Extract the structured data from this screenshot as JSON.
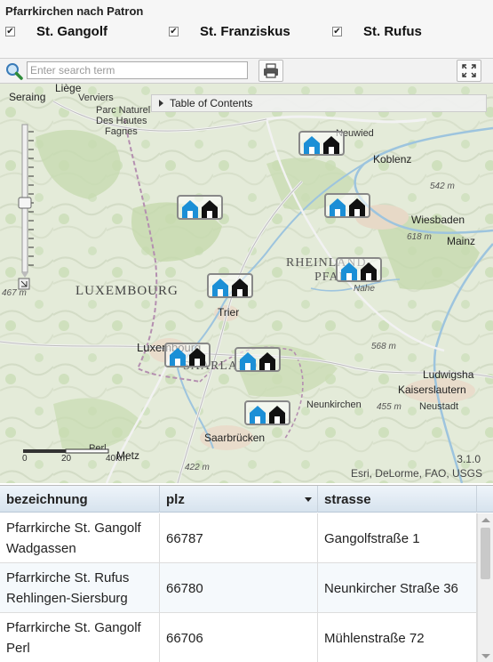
{
  "header": {
    "title": "Pfarrkirchen nach Patron",
    "legend": [
      {
        "label": "St. Gangolf",
        "checked": true,
        "check_mark": "✔"
      },
      {
        "label": "St. Franziskus",
        "checked": true,
        "check_mark": "✔"
      },
      {
        "label": "St. Rufus",
        "checked": true,
        "check_mark": "✔"
      }
    ]
  },
  "toolbar": {
    "search_placeholder": "Enter search term",
    "search_icon": "search-icon",
    "print_icon": "print-icon",
    "fullscreen_icon": "fullscreen-icon"
  },
  "map": {
    "toc_label": "Table of Contents",
    "labels": {
      "seraing": "Seraing",
      "liege": "Liège",
      "verviers": "Verviers",
      "parc_naturel": "Parc Naturel",
      "des_hautes": "Des Hautes",
      "fagnes": "Fagnes",
      "neuwied": "Neuwied",
      "koblenz": "Koblenz",
      "wiesbaden": "Wiesbaden",
      "mainz": "Mainz",
      "rheinland": "RHEINLAND-",
      "pfalz": "PFALZ",
      "nahe": "Nahe",
      "luxembourg_country": "LUXEMBOURG",
      "trier": "Trier",
      "luxembourg_city": "Luxembourg",
      "saarland": "SAARLAND",
      "ludwigshafen": "Ludwigsha",
      "kaiserslautern": "Kaiserslautern",
      "neustadt": "Neustadt",
      "neunkirchen": "Neunkirchen",
      "saarbruecken": "Saarbrücken",
      "perl": "Perl",
      "elev_542": "542 m",
      "elev_618": "618 m",
      "elev_467": "467 m",
      "elev_568": "568 m",
      "elev_455": "455 m",
      "elev_422": "422 m"
    },
    "scale": {
      "t0": "0",
      "t20": "20",
      "t40": "40km",
      "metz": "Metz"
    },
    "version": "3.1.0",
    "attribution": "Esri, DeLorme, FAO, USGS",
    "marker_colors": {
      "blue": "#1b8fd6",
      "black": "#111111"
    }
  },
  "table": {
    "columns": [
      "bezeichnung",
      "plz",
      "strasse"
    ],
    "sorted_column": "plz",
    "rows": [
      {
        "bezeichnung_1": "Pfarrkirche St. Gangolf",
        "bezeichnung_2": "Wadgassen",
        "plz": "66787",
        "strasse": "Gangolfstraße 1"
      },
      {
        "bezeichnung_1": "Pfarrkirche St. Rufus",
        "bezeichnung_2": "Rehlingen-Siersburg",
        "plz": "66780",
        "strasse": "Neunkircher Straße 36"
      },
      {
        "bezeichnung_1": "Pfarrkirche St. Gangolf",
        "bezeichnung_2": "Perl",
        "plz": "66706",
        "strasse": "Mühlenstraße 72"
      }
    ]
  }
}
